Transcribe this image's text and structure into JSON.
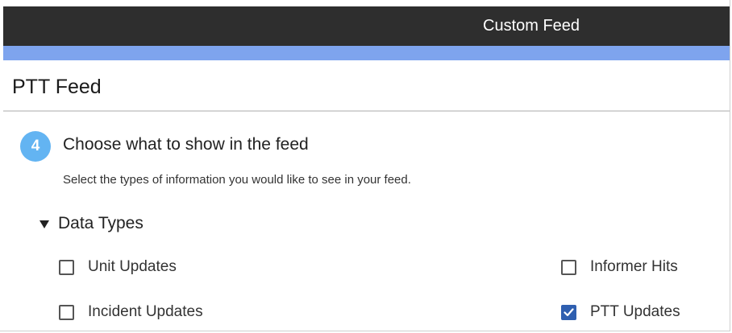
{
  "window": {
    "title": "Custom Feed",
    "colors": {
      "titlebar": "#2e2e2e",
      "accent_bar": "#7ea4ee",
      "step_badge": "#63b4f2",
      "checkbox_checked": "#2f5fb0"
    }
  },
  "page": {
    "title": "PTT Feed"
  },
  "step": {
    "number": "4",
    "heading": "Choose what to show in the feed",
    "description": "Select the types of information you would like to see in your feed."
  },
  "data_types": {
    "section_label": "Data Types",
    "section_icon": "expanded-triangle-icon",
    "expanded": true,
    "options": [
      {
        "label": "Unit Updates",
        "checked": false
      },
      {
        "label": "Informer Hits",
        "checked": false
      },
      {
        "label": "Incident Updates",
        "checked": false
      },
      {
        "label": "PTT Updates",
        "checked": true
      }
    ]
  }
}
